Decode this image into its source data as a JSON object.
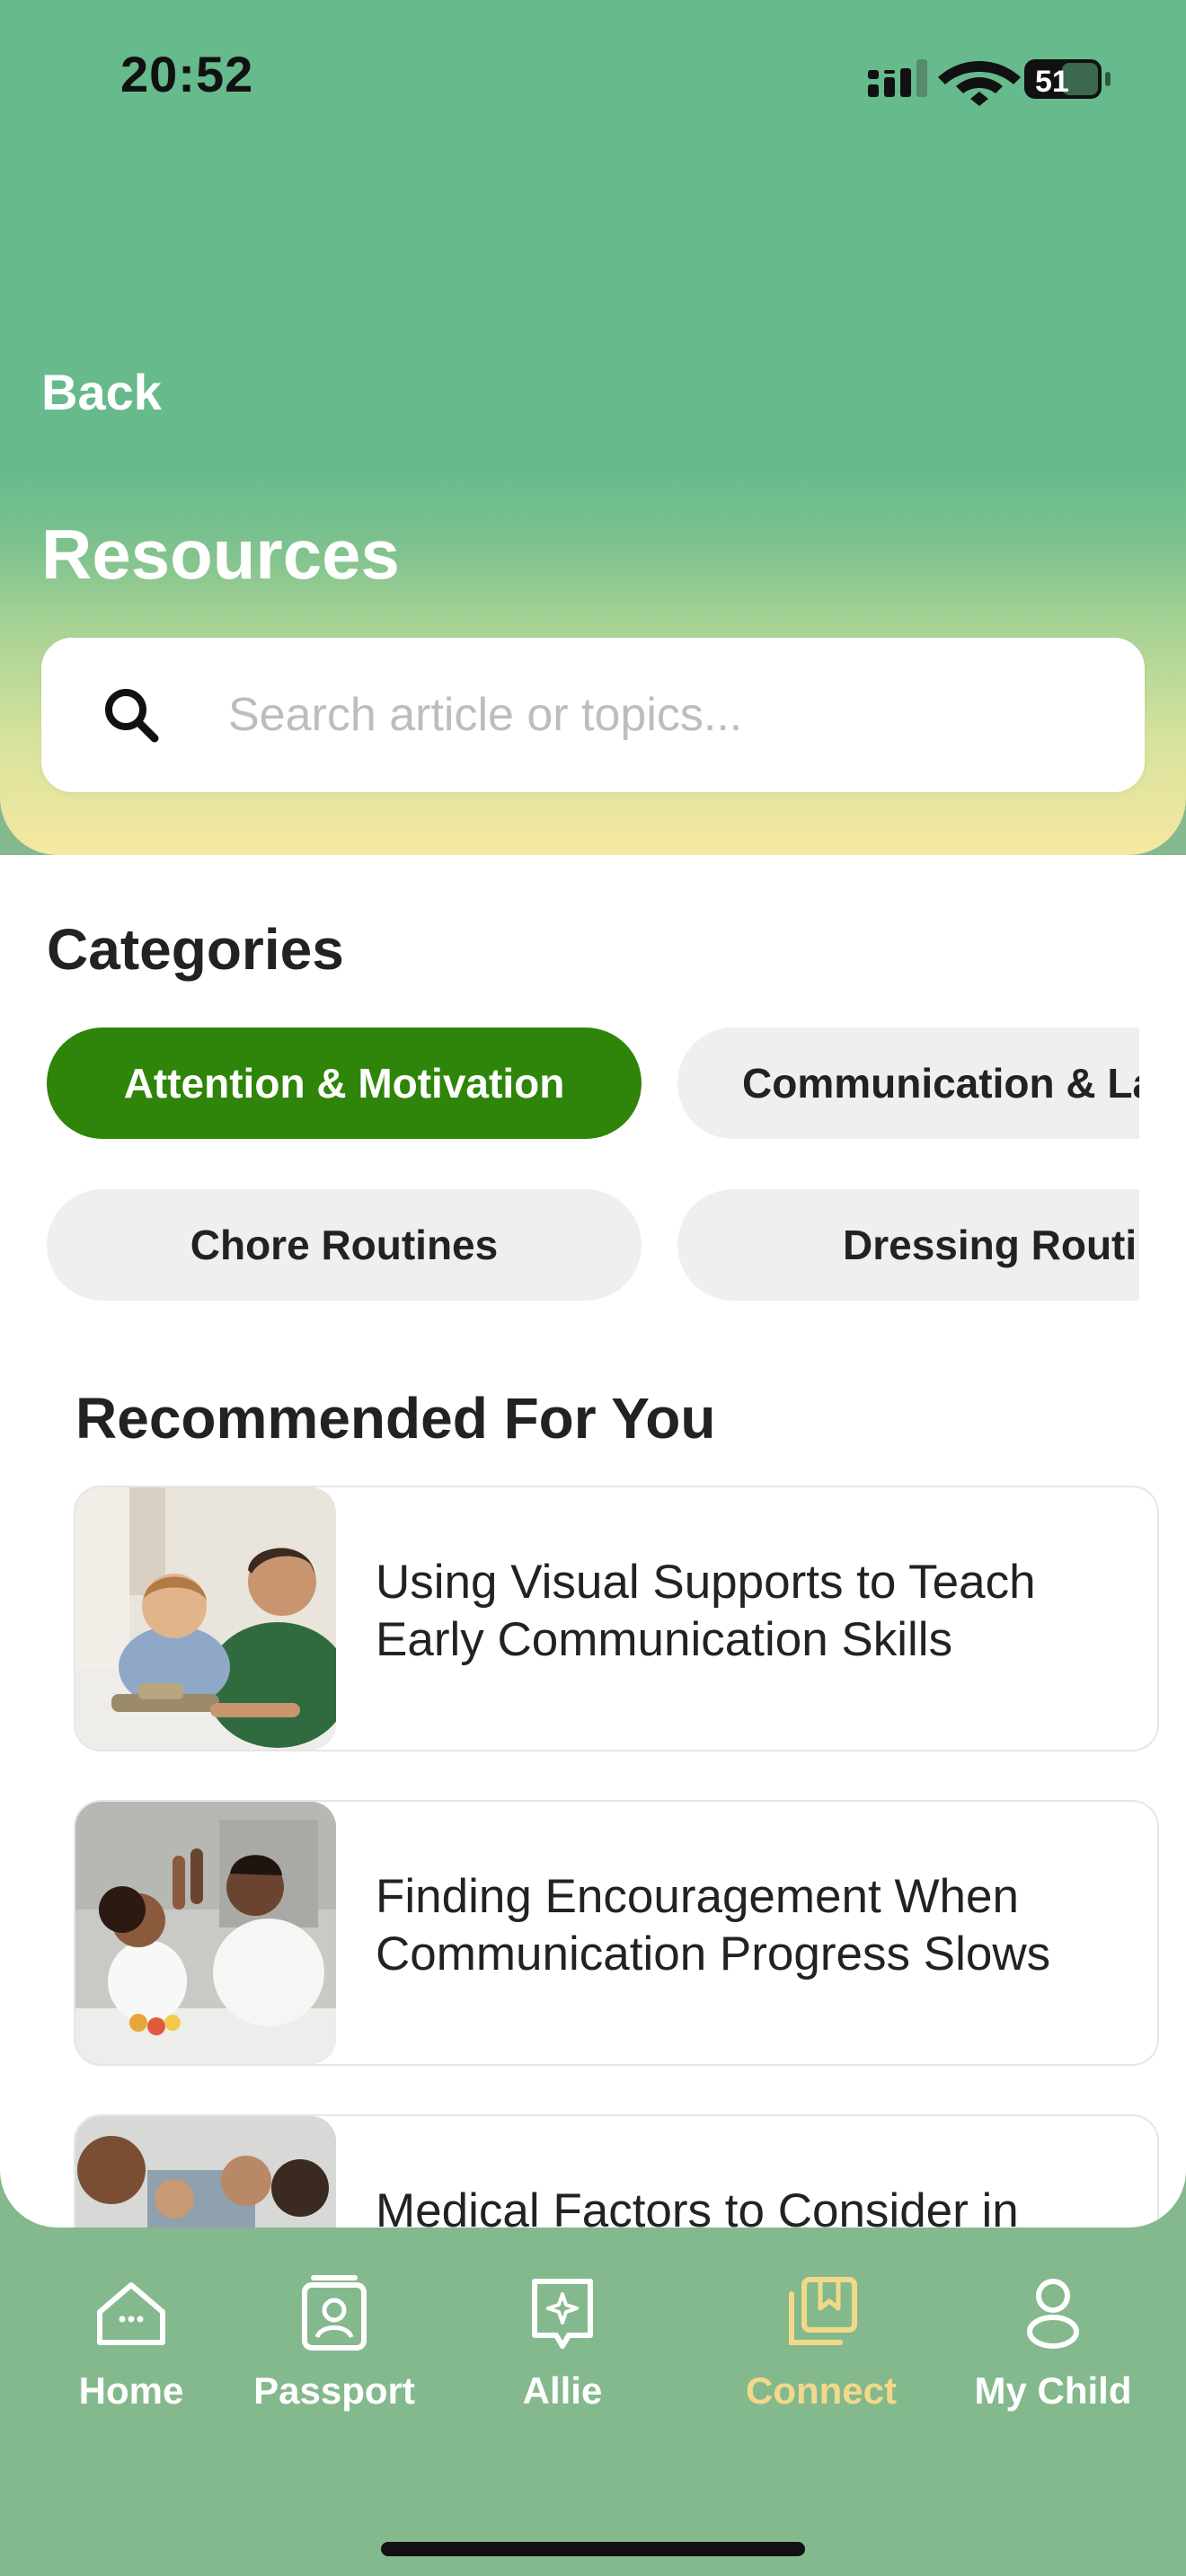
{
  "status_bar": {
    "time": "20:52",
    "battery": "51"
  },
  "header": {
    "back_label": "Back",
    "title": "Resources"
  },
  "search": {
    "placeholder": "Search article or topics..."
  },
  "categories": {
    "title": "Categories",
    "items": [
      {
        "label": "Attention & Motivation",
        "active": true
      },
      {
        "label": "Communication & Language",
        "active": false
      },
      {
        "label": "Chore Routines",
        "active": false
      },
      {
        "label": "Dressing Routines",
        "active": false
      }
    ]
  },
  "recommended": {
    "title": "Recommended For You",
    "articles": [
      {
        "title": "Using Visual Supports to Teach Early Communication Skills"
      },
      {
        "title": "Finding Encouragement When Communication Progress Slows"
      },
      {
        "title": "Medical Factors to Consider in"
      }
    ]
  },
  "nav": {
    "items": [
      {
        "label": "Home",
        "icon": "home-icon"
      },
      {
        "label": "Passport",
        "icon": "passport-icon"
      },
      {
        "label": "Allie",
        "icon": "allie-icon"
      },
      {
        "label": "Connect",
        "icon": "connect-icon",
        "active": true
      },
      {
        "label": "My Child",
        "icon": "person-icon"
      }
    ]
  },
  "colors": {
    "accent": "#2E8509",
    "nav_bg": "#84B98E",
    "nav_active": "#F2D98A",
    "header_green": "#66BA8C",
    "header_yellow": "#F6E8A2"
  }
}
